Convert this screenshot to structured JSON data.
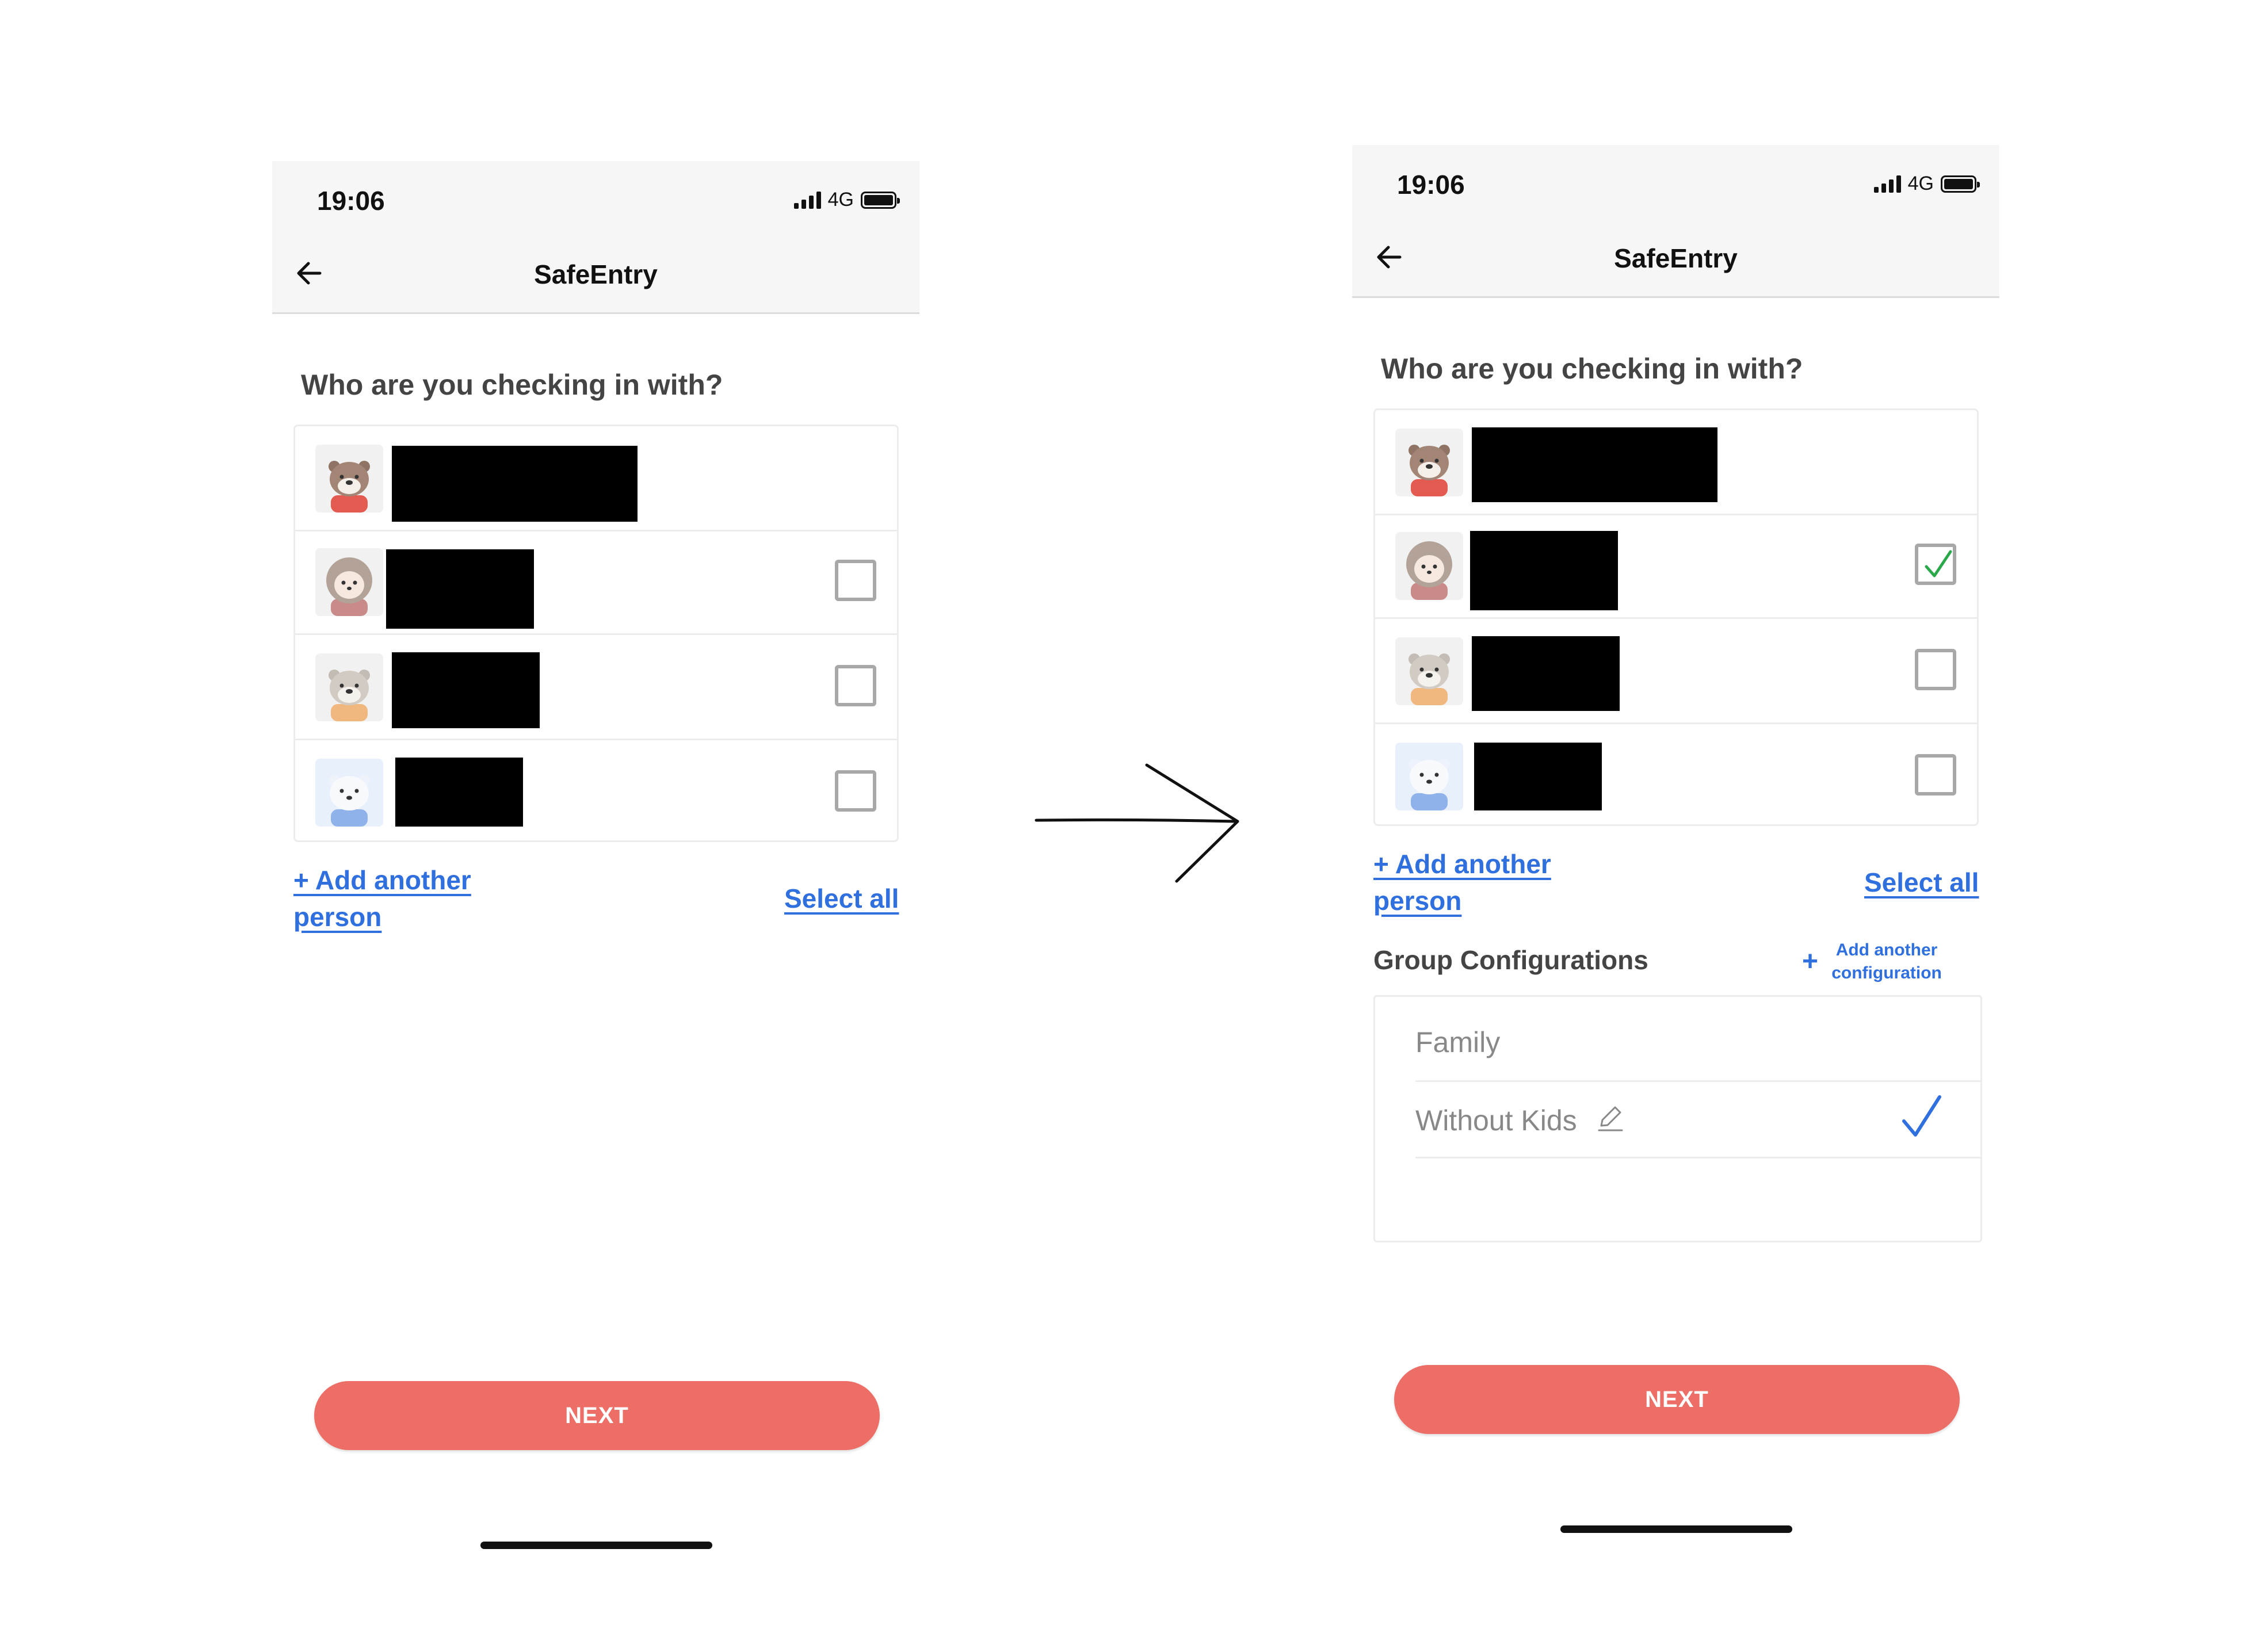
{
  "screens": [
    {
      "status": {
        "time": "19:06",
        "network": "4G"
      },
      "header": {
        "title": "SafeEntry"
      },
      "question": "Who are you checking in with?",
      "people": [
        {
          "avatar": "otter-avatar",
          "checked": null
        },
        {
          "avatar": "hedgehog-avatar",
          "checked": false
        },
        {
          "avatar": "otter-avatar-orange",
          "checked": false
        },
        {
          "avatar": "polar-bear-avatar",
          "checked": false
        }
      ],
      "links": {
        "add_person": "+ Add another person",
        "select_all": "Select all"
      },
      "next_label": "NEXT"
    },
    {
      "status": {
        "time": "19:06",
        "network": "4G"
      },
      "header": {
        "title": "SafeEntry"
      },
      "question": "Who are you checking in with?",
      "people": [
        {
          "avatar": "otter-avatar",
          "checked": null
        },
        {
          "avatar": "hedgehog-avatar",
          "checked": true
        },
        {
          "avatar": "otter-avatar-orange",
          "checked": false
        },
        {
          "avatar": "polar-bear-avatar",
          "checked": false
        }
      ],
      "links": {
        "add_person": "+ Add another person",
        "select_all": "Select all"
      },
      "group": {
        "title": "Group Configurations",
        "add_plus": "+",
        "add_label": "Add another configuration",
        "configs": [
          {
            "name": "Family",
            "selected": false
          },
          {
            "name": "Without Kids",
            "selected": true,
            "editable": true
          }
        ]
      },
      "next_label": "NEXT"
    }
  ],
  "colors": {
    "accent": "#2f6fde",
    "next_button": "#ec6e67",
    "check_green": "#2aa84a"
  }
}
